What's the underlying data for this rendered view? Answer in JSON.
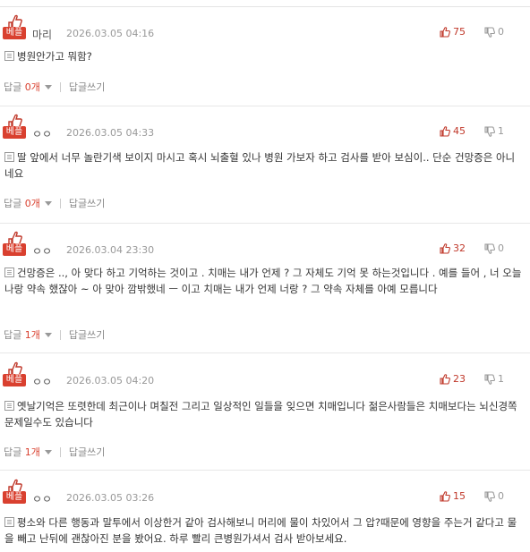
{
  "comments": [
    {
      "badge": "베플",
      "nick": "마리",
      "date": "2026.03.05 04:16",
      "up": "75",
      "down": "0",
      "text": "병원안가고 뭐함?",
      "reply_label": "답글",
      "reply_count": "0개",
      "write_label": "답글쓰기"
    },
    {
      "badge": "베플",
      "nick": "ㅇㅇ",
      "date": "2026.03.05 04:33",
      "up": "45",
      "down": "1",
      "text": "딸 앞에서 너무 놀란기색 보이지 마시고 혹시 뇌출혈 있나 병원 가보자 하고 검사를 받아 보심이.. 단순 건망증은 아니네요",
      "reply_label": "답글",
      "reply_count": "0개",
      "write_label": "답글쓰기"
    },
    {
      "badge": "베플",
      "nick": "ㅇㅇ",
      "date": "2026.03.04 23:30",
      "up": "32",
      "down": "0",
      "text": "건망증은 .., 아 맞다 하고 기억하는 것이고 . 치매는 내가 언제 ? 그 자체도 기억 못 하는것입니다 . 예를 들어 , 너 오늘 나랑 약속 했잖아 ~ 아 맞아 깜밖했네 ㅡ 이고 치매는 내가 언제 너랑 ? 그 약속 자체를 아예 모릅니다",
      "reply_label": "답글",
      "reply_count": "1개",
      "write_label": "답글쓰기"
    },
    {
      "badge": "베플",
      "nick": "ㅇㅇ",
      "date": "2026.03.05 04:20",
      "up": "23",
      "down": "1",
      "text": "옛날기억은 또렷한데 최근이나 며칠전 그리고 일상적인 일들을 잊으면 치매입니다 젊은사람들은 치매보다는 뇌신경쪽 문제일수도 있습니다",
      "reply_label": "답글",
      "reply_count": "1개",
      "write_label": "답글쓰기"
    },
    {
      "badge": "베플",
      "nick": "ㅇㅇ",
      "date": "2026.03.05 03:26",
      "up": "15",
      "down": "0",
      "text": "평소와 다른 행동과 말투에서 이상한거 같아 검사해보니 머리에 물이 차있어서 그 압?때문에 영향을 주는거 같다고 물을 빼고 난뒤에 괜찮아진 분을 봤어요. 하루 빨리 큰병원가셔서 검사 받아보세요.",
      "reply_label": "",
      "reply_count": "",
      "write_label": ""
    }
  ],
  "colors": {
    "accent": "#d9402f",
    "up": "#c0392b",
    "muted": "#999999"
  },
  "icons": {
    "badge": "thumb-hand-icon",
    "up": "thumbs-up-icon",
    "down": "thumbs-down-icon",
    "memo": "memo-icon",
    "caret": "caret-down-icon"
  }
}
